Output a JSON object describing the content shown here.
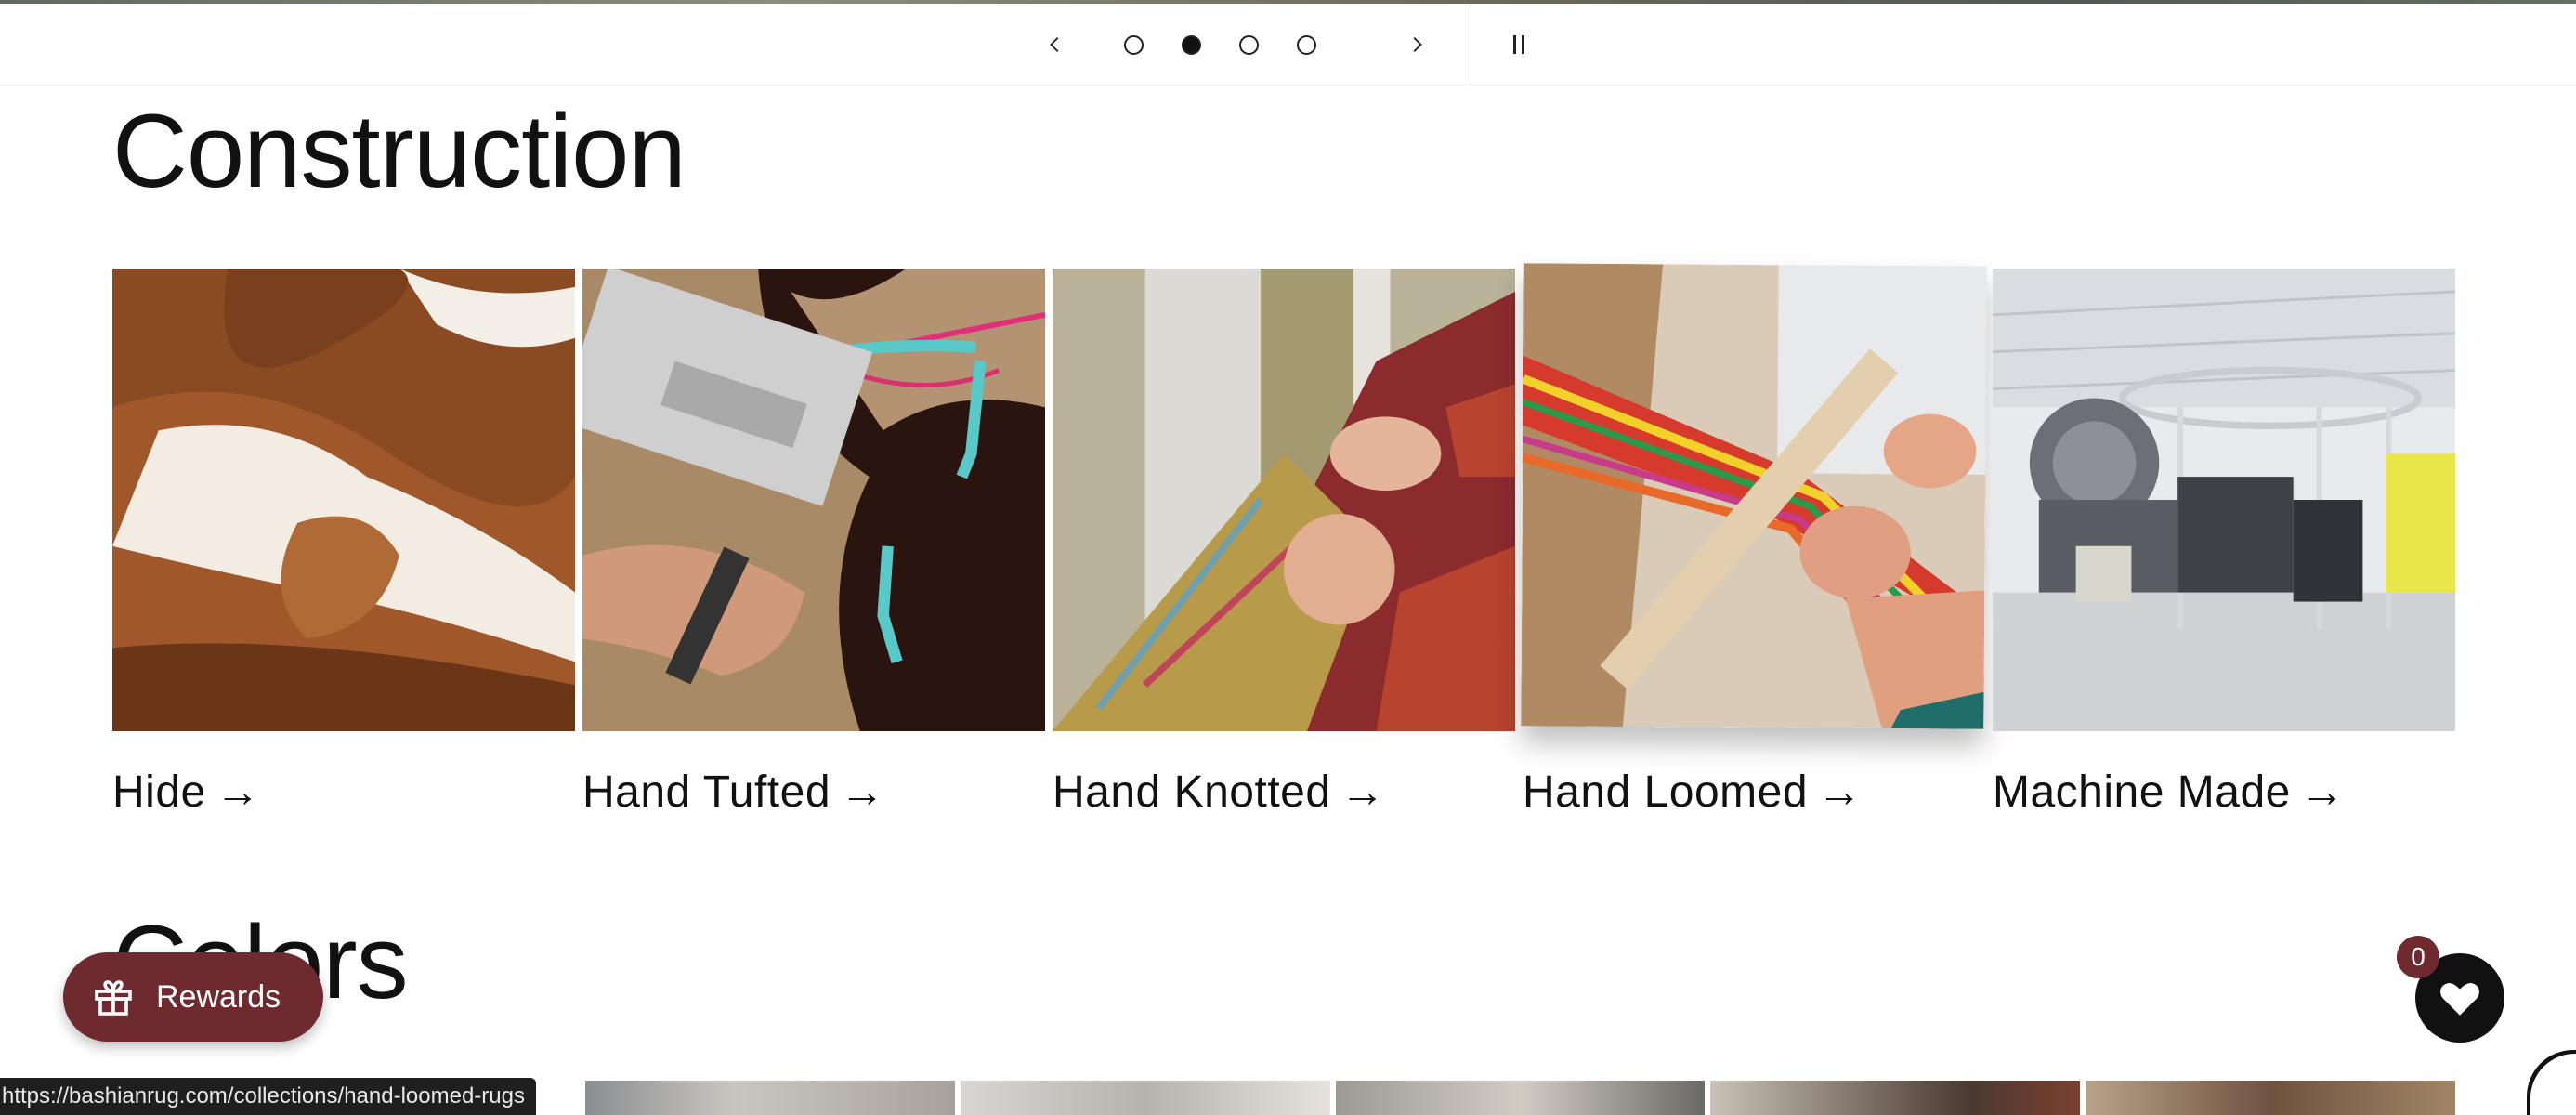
{
  "slider": {
    "prev_icon": "chevron-left-icon",
    "next_icon": "chevron-right-icon",
    "pause_icon": "pause-icon",
    "slide_count": 4,
    "active_slide": 2
  },
  "construction": {
    "title": "Construction",
    "items": [
      {
        "label": "Hide",
        "arrow": "→"
      },
      {
        "label": "Hand Tufted",
        "arrow": "→"
      },
      {
        "label": "Hand Knotted",
        "arrow": "→"
      },
      {
        "label": "Hand Loomed",
        "arrow": "→"
      },
      {
        "label": "Machine Made",
        "arrow": "→"
      }
    ]
  },
  "colors": {
    "title": "Colors"
  },
  "rewards": {
    "label": "Rewards",
    "icon": "gift-icon",
    "color": "#6e2a2e"
  },
  "wishlist": {
    "count": "0",
    "icon": "heart-icon"
  },
  "status_bar": {
    "url": "https://bashianrug.com/collections/hand-loomed-rugs"
  }
}
